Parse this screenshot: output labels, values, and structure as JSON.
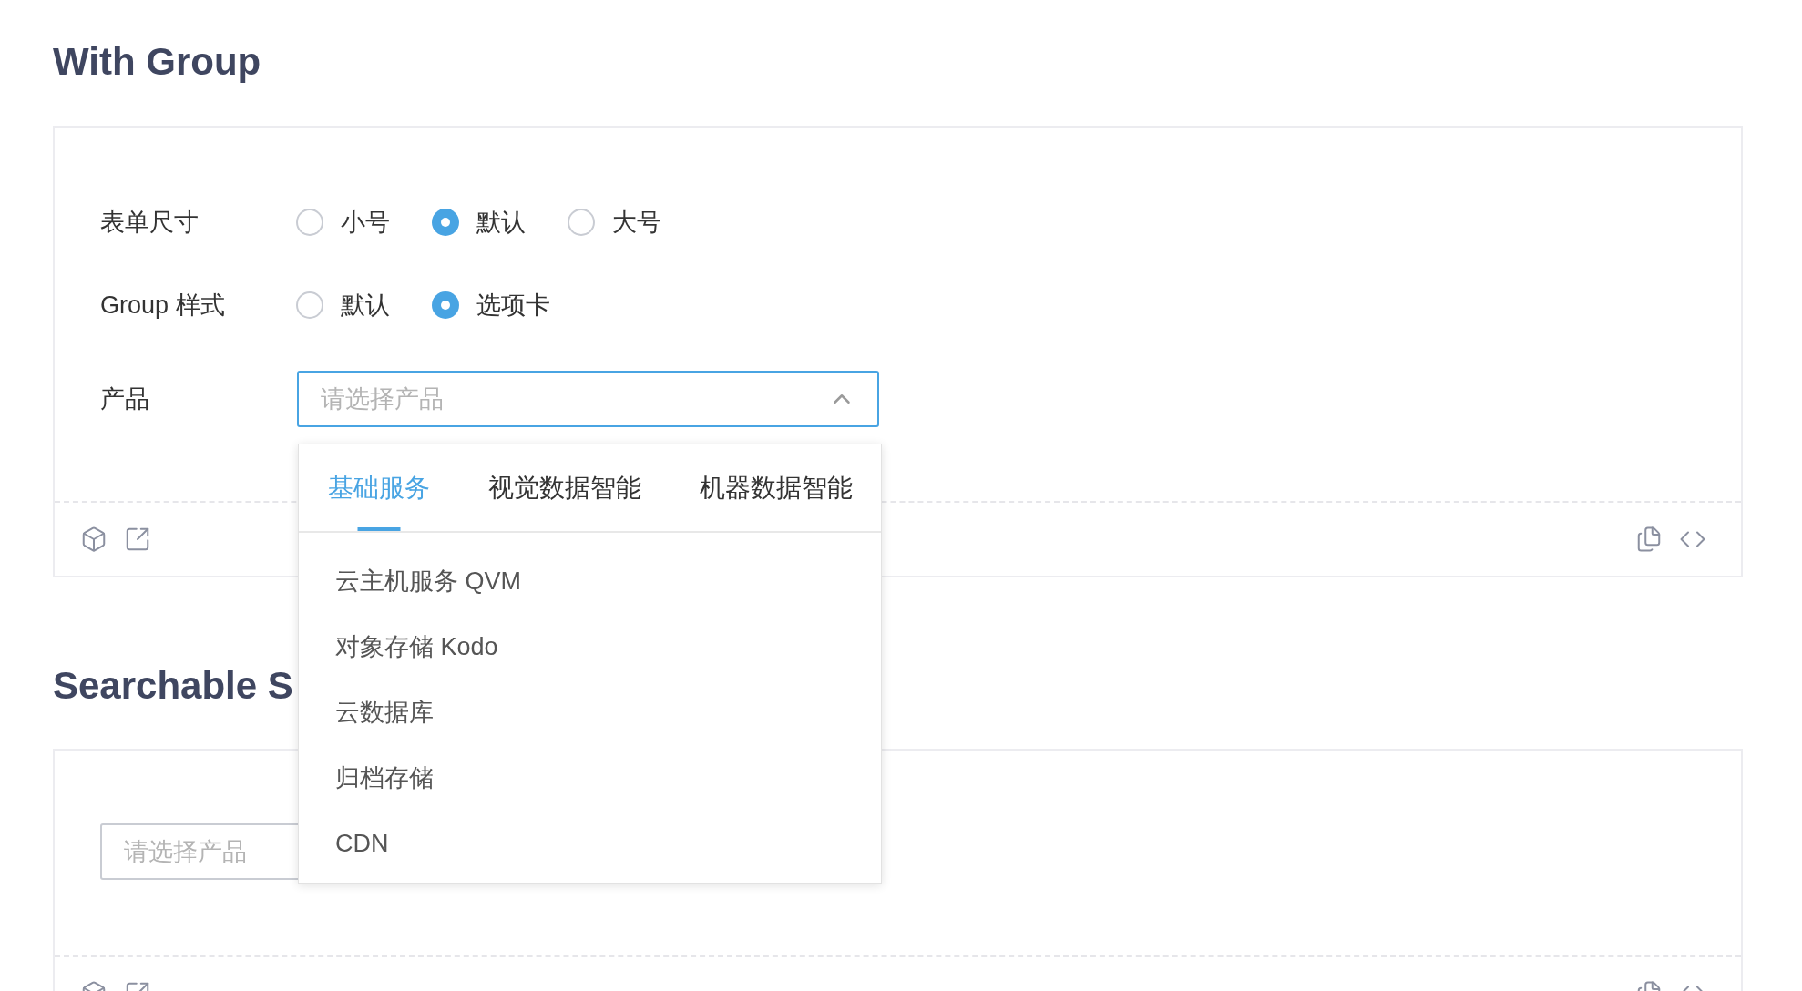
{
  "sections": [
    {
      "title": "With Group",
      "form": {
        "rows": [
          {
            "kind": "radio",
            "label": "表单尺寸",
            "options": [
              {
                "label": "小号",
                "selected": false
              },
              {
                "label": "默认",
                "selected": true
              },
              {
                "label": "大号",
                "selected": false
              }
            ]
          },
          {
            "kind": "radio",
            "label": "Group 样式",
            "options": [
              {
                "label": "默认",
                "selected": false
              },
              {
                "label": "选项卡",
                "selected": true
              }
            ]
          },
          {
            "kind": "select",
            "label": "产品",
            "placeholder": "请选择产品",
            "expanded": true
          }
        ]
      },
      "dropdown": {
        "tabs": [
          {
            "label": "基础服务",
            "selected": true
          },
          {
            "label": "视觉数据智能",
            "selected": false
          },
          {
            "label": "机器数据智能",
            "selected": false
          }
        ],
        "items": [
          "云主机服务 QVM",
          "对象存储 Kodo",
          "云数据库",
          "归档存储",
          "CDN"
        ]
      }
    },
    {
      "title": "Searchable S",
      "select": {
        "placeholder": "请选择产品"
      }
    }
  ]
}
